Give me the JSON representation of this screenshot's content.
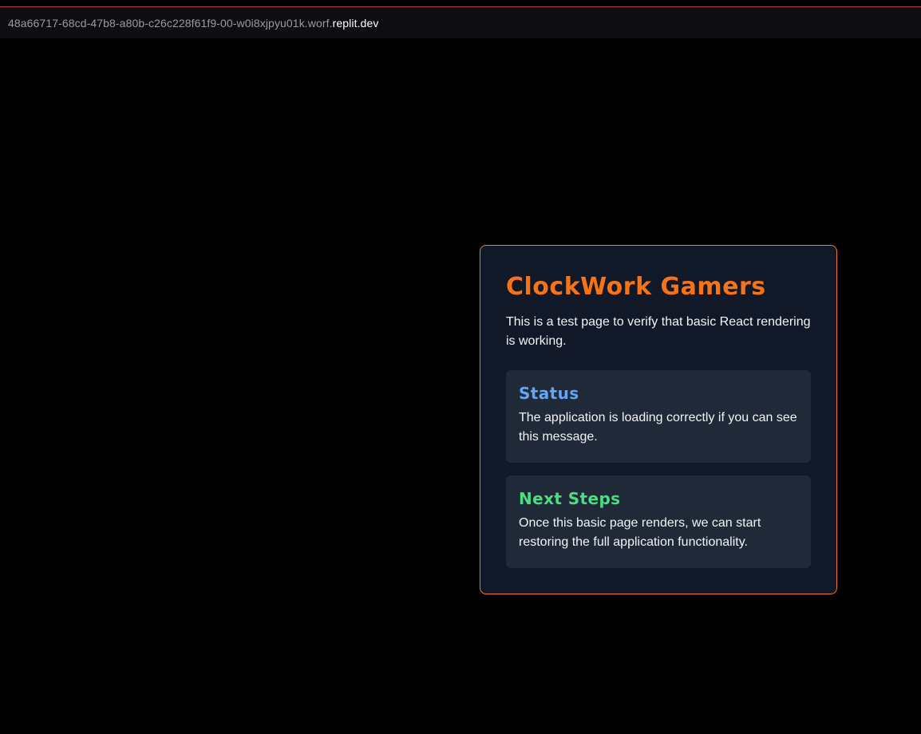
{
  "browser": {
    "url_subdomain": "48a66717-68cd-47b8-a80b-c26c228f61f9-00-w0i8xjpyu01k.worf.",
    "url_domain": "replit.dev"
  },
  "card": {
    "title": "ClockWork Gamers",
    "intro": "This is a test page to verify that basic React rendering is working.",
    "panels": [
      {
        "title": "Status",
        "text": "The application is loading correctly if you can see this message.",
        "title_color": "#60a5fa"
      },
      {
        "title": "Next Steps",
        "text": "Once this basic page renders, we can start restoring the full application functionality.",
        "title_color": "#4ade80"
      }
    ]
  },
  "colors": {
    "accent": "#f97316",
    "card_border": "#ea7b2a",
    "card_bg": "#111827",
    "panel_bg": "#1f2937",
    "page_bg": "#000000"
  }
}
